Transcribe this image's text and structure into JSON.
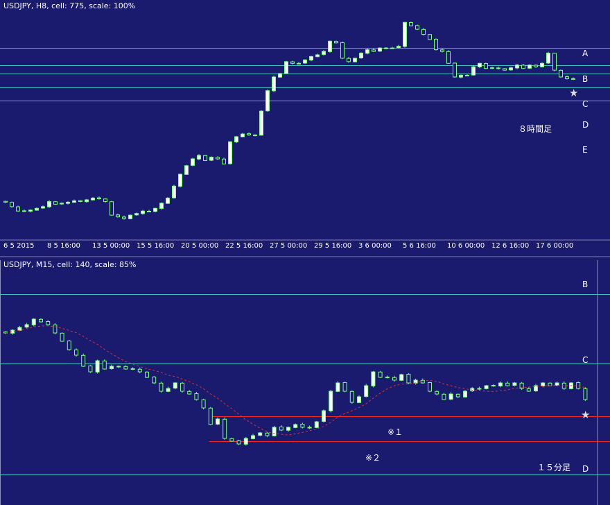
{
  "chart_data": [
    {
      "type": "candlestick",
      "title": "USDJPY, H8, cell: 775, scale: 100%",
      "x_tick_labels": [
        "6 5 2015",
        "8 5 16:00",
        "13 5 00:00",
        "15 5 16:00",
        "20 5 00:00",
        "22 5 16:00",
        "27 5 00:00",
        "29 5 16:00",
        "3 6 00:00",
        "5 6 16:00",
        "10 6 00:00",
        "12 6 16:00",
        "17 6 00:00"
      ],
      "levels": [
        {
          "label": "A",
          "color": "#40c0c0",
          "y_value": 124.4
        },
        {
          "label": "B",
          "color": "#40c0c0",
          "y_value": 123.9
        },
        {
          "label": "C",
          "color": "#40c0c0",
          "y_value": 123.65
        },
        {
          "label": "D",
          "color": "#40c0c0",
          "y_value": 123.25
        },
        {
          "label": "E",
          "color": "#40c0c0",
          "y_value": 122.85
        }
      ],
      "annotation": "８時間足",
      "marker": "★",
      "closes": [
        119.88,
        119.75,
        119.62,
        119.62,
        119.65,
        119.7,
        119.75,
        119.9,
        119.82,
        119.85,
        119.88,
        119.92,
        119.9,
        119.95,
        120.0,
        119.98,
        119.9,
        119.5,
        119.45,
        119.4,
        119.5,
        119.55,
        119.62,
        119.6,
        119.7,
        119.85,
        120.0,
        120.35,
        120.7,
        120.95,
        121.15,
        121.25,
        121.1,
        121.2,
        121.15,
        121.0,
        121.65,
        121.8,
        121.88,
        121.85,
        121.85,
        122.55,
        123.15,
        123.55,
        123.65,
        124.0,
        123.95,
        123.95,
        124.05,
        124.15,
        124.2,
        124.3,
        124.6,
        124.55,
        124.1,
        124.0,
        124.1,
        124.25,
        124.35,
        124.3,
        124.4,
        124.4,
        124.4,
        124.45,
        125.15,
        125.05,
        124.95,
        124.8,
        124.65,
        124.35,
        124.3,
        123.95,
        123.55,
        123.6,
        123.6,
        123.85,
        123.95,
        123.8,
        123.82,
        123.8,
        123.75,
        123.82,
        123.9,
        123.8,
        123.9,
        123.85,
        123.95,
        124.25,
        123.75,
        123.55,
        123.5,
        123.5
      ]
    },
    {
      "type": "candlestick",
      "title": "USDJPY, M15, cell: 140, scale: 85%",
      "levels": [
        {
          "label": "B",
          "color": "#40c0c0",
          "y_value": 123.9
        },
        {
          "label": "C",
          "color": "#40c0c0",
          "y_value": 123.65
        },
        {
          "label": "D",
          "color": "#40c0c0",
          "y_value": 123.25
        }
      ],
      "support_lines": [
        {
          "label": "※１",
          "color": "#ff2020",
          "y_value": 123.46
        },
        {
          "label": "※２",
          "color": "#ff2020",
          "y_value": 123.37
        }
      ],
      "moving_average": {
        "style": "dashed",
        "color": "#e03030"
      },
      "annotation": "１５分足",
      "marker": "★",
      "closes": [
        123.76,
        123.77,
        123.78,
        123.79,
        123.81,
        123.8,
        123.79,
        123.76,
        123.73,
        123.7,
        123.68,
        123.64,
        123.62,
        123.66,
        123.63,
        123.64,
        123.64,
        123.63,
        123.63,
        123.62,
        123.6,
        123.58,
        123.55,
        123.56,
        123.58,
        123.55,
        123.54,
        123.52,
        123.49,
        123.43,
        123.45,
        123.38,
        123.37,
        123.36,
        123.38,
        123.39,
        123.4,
        123.39,
        123.42,
        123.41,
        123.42,
        123.43,
        123.42,
        123.42,
        123.44,
        123.48,
        123.55,
        123.58,
        123.55,
        123.51,
        123.53,
        123.57,
        123.62,
        123.6,
        123.6,
        123.59,
        123.61,
        123.58,
        123.59,
        123.58,
        123.55,
        123.54,
        123.52,
        123.54,
        123.53,
        123.55,
        123.56,
        123.56,
        123.57,
        123.57,
        123.58,
        123.57,
        123.58,
        123.56,
        123.55,
        123.57,
        123.58,
        123.57,
        123.58,
        123.56,
        123.58,
        123.56,
        123.52
      ]
    }
  ]
}
